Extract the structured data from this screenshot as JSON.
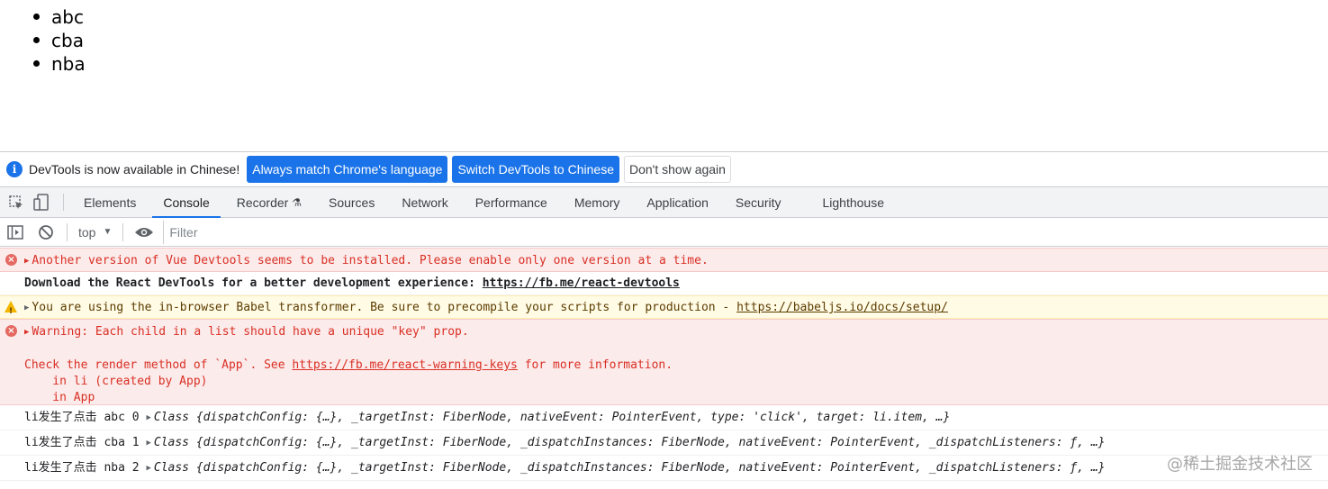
{
  "page": {
    "list_items": [
      "abc",
      "cba",
      "nba"
    ]
  },
  "infobar": {
    "message": "DevTools is now available in Chinese!",
    "btn_match": "Always match Chrome's language",
    "btn_switch": "Switch DevTools to Chinese",
    "btn_dismiss": "Don't show again"
  },
  "tabs": [
    "Elements",
    "Console",
    "Recorder",
    "Sources",
    "Network",
    "Performance",
    "Memory",
    "Application",
    "Security",
    "Lighthouse"
  ],
  "active_tab": "Console",
  "toolbar": {
    "context": "top",
    "filter_placeholder": "Filter"
  },
  "console": {
    "msg1": "Another version of Vue Devtools seems to be installed. Please enable only one version at a time.",
    "msg2_text": "Download the React DevTools for a better development experience: ",
    "msg2_link": "https://fb.me/react-devtools",
    "msg3_text": "You are using the in-browser Babel transformer. Be sure to precompile your scripts for production - ",
    "msg3_link": "https://babeljs.io/docs/setup/",
    "msg4_line1": "Warning: Each child in a list should have a unique \"key\" prop.",
    "msg4_line2_pre": "Check the render method of `App`. See ",
    "msg4_link": "https://fb.me/react-warning-keys",
    "msg4_line2_post": " for more information.",
    "msg4_line3": "    in li (created by App)",
    "msg4_line4": "    in App",
    "log1_prefix": "li发生了点击 abc 0 ",
    "log1_obj": "Class {dispatchConfig: {…}, _targetInst: FiberNode, nativeEvent: PointerEvent, type: 'click', target: li.item, …}",
    "log2_prefix": "li发生了点击 cba 1 ",
    "log2_obj": "Class {dispatchConfig: {…}, _targetInst: FiberNode, _dispatchInstances: FiberNode, nativeEvent: PointerEvent, _dispatchListeners: ƒ, …}",
    "log3_prefix": "li发生了点击 nba 2 ",
    "log3_obj": "Class {dispatchConfig: {…}, _targetInst: FiberNode, _dispatchInstances: FiberNode, nativeEvent: PointerEvent, _dispatchListeners: ƒ, …}"
  },
  "watermark": "@稀土掘金技术社区",
  "colors": {
    "accent": "#1a73e8",
    "error": "#d93025",
    "warning_bg": "#fffbe5",
    "error_bg": "#fcebeb"
  }
}
